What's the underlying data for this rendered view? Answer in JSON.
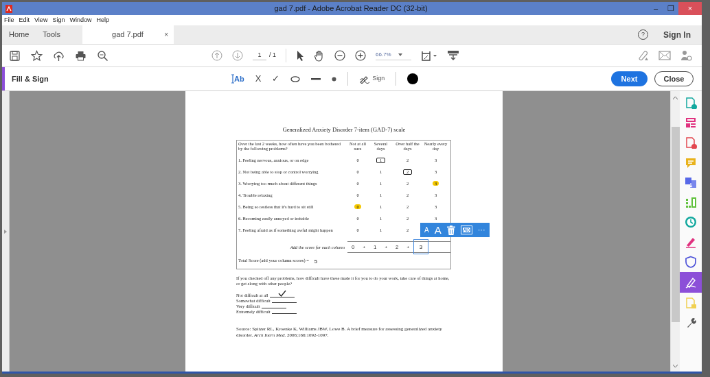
{
  "window": {
    "title": "gad 7.pdf - Adobe Acrobat Reader DC (32-bit)",
    "controls": [
      "–",
      "❐",
      "×"
    ]
  },
  "menu": [
    "File",
    "Edit",
    "View",
    "Sign",
    "Window",
    "Help"
  ],
  "tabs": [
    {
      "label": "Home",
      "selected": false
    },
    {
      "label": "Tools",
      "selected": false
    },
    {
      "label": "gad 7.pdf",
      "selected": true,
      "close": "×"
    }
  ],
  "help": "?",
  "sign_in": "Sign In",
  "toolbar": {
    "page": "1",
    "page_count": "/ 1",
    "zoom": "66.7%"
  },
  "fill_sign": {
    "title": "Fill & Sign",
    "text_tool": "Ab",
    "tools": [
      {
        "kind": "cross",
        "label": "X"
      },
      {
        "kind": "check",
        "label": "✓"
      },
      {
        "kind": "ellipse"
      },
      {
        "kind": "line"
      },
      {
        "kind": "dot"
      }
    ],
    "sign": "Sign",
    "color": "#000000",
    "next": "Next",
    "close": "Close"
  },
  "document": {
    "title": "Generalized Anxiety Disorder 7-item (GAD-7) scale",
    "question": "Over the last 2 weeks, how often have you been bothered by the following problems?",
    "columns": [
      "Not at all sure",
      "Several days",
      "Over half the days",
      "Nearly every day"
    ],
    "items": [
      {
        "text": "1.  Feeling nervous, anxious, or on edge",
        "scores": [
          {
            "value": "0"
          },
          {
            "value": "1",
            "boxed": true
          },
          {
            "value": "2"
          },
          {
            "value": "3"
          }
        ]
      },
      {
        "text": "2.  Not being able to stop or control worrying",
        "scores": [
          {
            "value": "0"
          },
          {
            "value": "1"
          },
          {
            "value": "2",
            "boxed": true
          },
          {
            "value": "3"
          }
        ]
      },
      {
        "text": "3.  Worrying too much about different things",
        "scores": [
          {
            "value": "0"
          },
          {
            "value": "1"
          },
          {
            "value": "2"
          },
          {
            "value": "3",
            "highlighted": true
          }
        ]
      },
      {
        "text": "4.  Trouble relaxing",
        "scores": [
          {
            "value": "0"
          },
          {
            "value": "1"
          },
          {
            "value": "2"
          },
          {
            "value": "3"
          }
        ]
      },
      {
        "text": "5.  Being so restless that it's hard to sit still",
        "scores": [
          {
            "value": "0",
            "highlighted": true
          },
          {
            "value": "1"
          },
          {
            "value": "2"
          },
          {
            "value": "3"
          }
        ]
      },
      {
        "text": "6.  Becoming easily annoyed or irritable",
        "scores": [
          {
            "value": "0"
          },
          {
            "value": "1"
          },
          {
            "value": "2"
          },
          {
            "value": "3"
          }
        ]
      },
      {
        "text": "7.  Feeling afraid as if something awful might happen",
        "scores": [
          {
            "value": "0"
          },
          {
            "value": "1"
          },
          {
            "value": "2"
          }
        ]
      }
    ],
    "sum_label": "Add the score for each column",
    "column_sums": [
      {
        "value": "0",
        "selected": false
      },
      {
        "value": "1",
        "selected": false
      },
      {
        "value": "2",
        "selected": false
      },
      {
        "value": "3",
        "selected": true
      }
    ],
    "operators": [
      "+",
      "+",
      "+"
    ],
    "total_label": "Total Score (add your column scores) =",
    "total": "5",
    "difficulty_question": "If you checked off any problems, how difficult have these made it for you to do your work, take care of things at home, or get along with other people?",
    "options": [
      {
        "label": "Not difficult at all",
        "checked": true
      },
      {
        "label": "Somewhat difficult",
        "checked": false
      },
      {
        "label": "Very difficult",
        "checked": false
      },
      {
        "label": "Extremely difficult",
        "checked": false
      }
    ],
    "source": "Source: Spitzer RL, Kroenke K, Williams JBW, Lowe B. A brief measure for assessing generalized anxiety disorder. *Arch Inern Med.* 2006;166:1092-1097."
  },
  "text_toolbar": {
    "small": "A",
    "large": "A",
    "more": "···"
  },
  "tools_panel": [
    {
      "kind": "doc-plus",
      "color": "#13a89e",
      "selected": false
    },
    {
      "kind": "layout",
      "color": "#e0317f",
      "selected": false
    },
    {
      "kind": "doc-plus",
      "color": "#e2474f",
      "selected": false
    },
    {
      "kind": "comment",
      "color": "#e8b21c",
      "selected": false
    },
    {
      "kind": "combine",
      "color": "#5869e8",
      "selected": false
    },
    {
      "kind": "compress",
      "color": "#5fc13b",
      "selected": false
    },
    {
      "kind": "clock",
      "color": "#13a89e",
      "selected": false
    },
    {
      "kind": "pen",
      "color": "#e0317f",
      "selected": false
    },
    {
      "kind": "shield",
      "color": "#4b50d8",
      "selected": false
    },
    {
      "kind": "sign",
      "color": "#8c4fd8",
      "selected": true
    },
    {
      "kind": "doc",
      "color": "#f0d050",
      "selected": false
    },
    {
      "kind": "wrench",
      "color": "#555555",
      "selected": false
    }
  ]
}
